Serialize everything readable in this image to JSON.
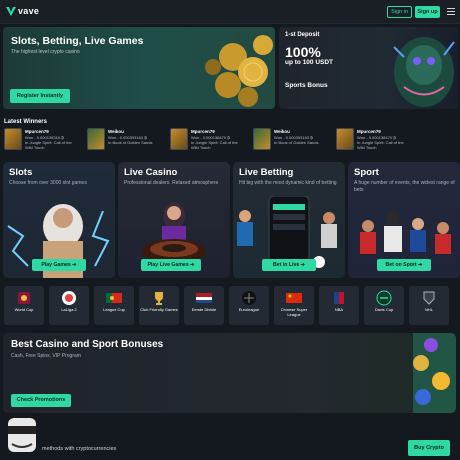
{
  "header": {
    "logo_text": "vave",
    "signin_label": "Sign in",
    "signup_label": "Sign up"
  },
  "hero": {
    "title": "Slots, Betting, Live Games",
    "subtitle": "The highest level crypto casino",
    "button": "Register Instantly"
  },
  "promo": {
    "line1": "1-st Deposit",
    "line2": "100%",
    "line3": "up to 100 USDT",
    "line4": "Sports Bonus"
  },
  "winners": {
    "title": "Latest Winners",
    "items": [
      {
        "name": "Mpurcen79",
        "amount": "Won - 0.000139316 ₿",
        "game": "In Jungle Spirit: Call of the Wild Touch"
      },
      {
        "name": "Weikou",
        "amount": "Won - 0.000393163 ₿",
        "game": "In Book of Golden Sands"
      },
      {
        "name": "Mpurcen79",
        "amount": "Won - 0.000138470 ₿",
        "game": "In Jungle Spirit: Call of the Wild Touch"
      },
      {
        "name": "Weikou",
        "amount": "Won - 0.000393163 ₿",
        "game": "In Book of Golden Sands"
      },
      {
        "name": "Mpurcen79",
        "amount": "Won - 0.000138470 ₿",
        "game": "In Jungle Spirit: Call of the Wild Touch"
      }
    ]
  },
  "cards": [
    {
      "title": "Slots",
      "desc": "Choose from over 3000 slot games",
      "button": "Play Games"
    },
    {
      "title": "Live Casino",
      "desc": "Professional dealers. Relaxed atmosphere",
      "button": "Play Live Games"
    },
    {
      "title": "Live Betting",
      "desc": "Hit big with the most dynamic kind of betting",
      "button": "Bet in Live"
    },
    {
      "title": "Sport",
      "desc": "A huge number of events, the widest range of bets",
      "button": "Bet on Sport"
    }
  ],
  "sports": [
    {
      "label": "World Cup"
    },
    {
      "label": "LaLiga 2"
    },
    {
      "label": "League Cup"
    },
    {
      "label": "Club Friendly Games"
    },
    {
      "label": "Eerste Divisie"
    },
    {
      "label": "Euroleague"
    },
    {
      "label": "Chinese Super League"
    },
    {
      "label": "NBA"
    },
    {
      "label": "Davis Cup"
    },
    {
      "label": "NHL"
    }
  ],
  "bonus": {
    "title": "Best Casino and Sport Bonuses",
    "subtitle": "Cash, Free Spins, VIP Program",
    "button": "Check Promotions"
  },
  "footer": {
    "text": "methods with cryptocurrencies",
    "button": "Buy Crypto"
  },
  "colors": {
    "accent": "#2fd9a3",
    "background": "#14181f",
    "card": "#232a33"
  }
}
